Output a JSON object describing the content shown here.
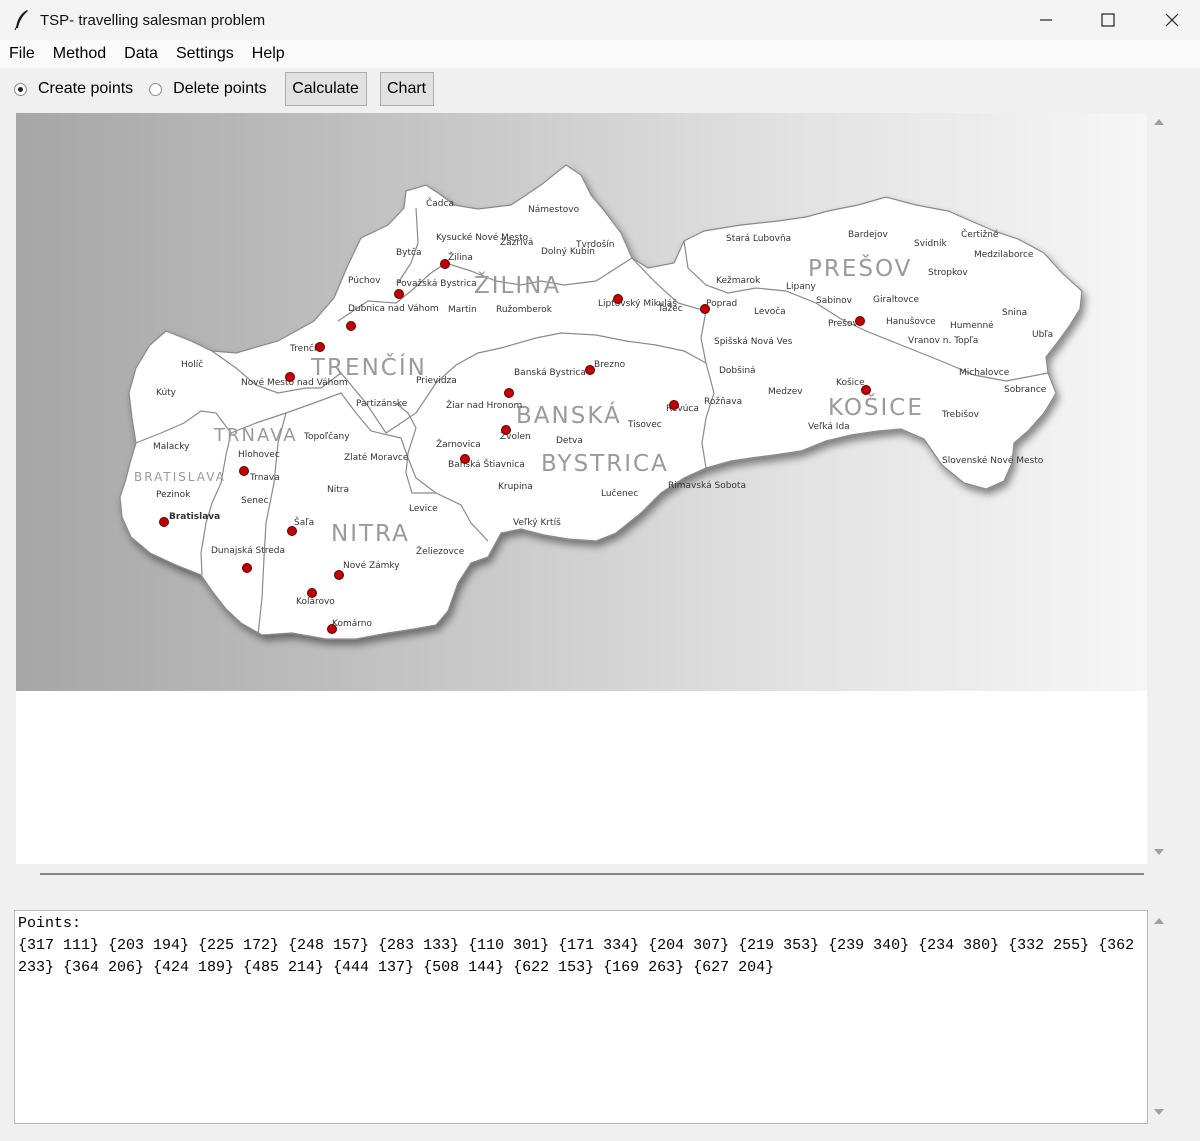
{
  "window": {
    "title": "TSP- travelling salesman problem"
  },
  "menu": [
    "File",
    "Method",
    "Data",
    "Settings",
    "Help"
  ],
  "toolbar": {
    "create_label": "Create points",
    "delete_label": "Delete points",
    "selected_mode": "Create points",
    "calculate_label": "Calculate",
    "chart_label": "Chart"
  },
  "map": {
    "regions": [
      "ŽILINA",
      "TRENČÍN",
      "TRNAVA",
      "BRATISLAVA",
      "NITRA",
      "BANSKÁ",
      "BYSTRICA",
      "PREŠOV",
      "KOŠICE"
    ],
    "towns": [
      "Čadca",
      "Kysucké Nové Mesto",
      "Námestovo",
      "Bytča",
      "Žilina",
      "Zázrivá",
      "Dolný Kubín",
      "Tvrdošín",
      "Púchov",
      "Považská Bystrica",
      "Martin",
      "Ružomberok",
      "Liptovský Mikuláš",
      "Ťažec",
      "Poprad",
      "Dubnica nad Váhom",
      "Trenčín",
      "Holíč",
      "Nové Mesto nad Váhom",
      "Prievidza",
      "Partizánske",
      "Kúty",
      "Malacky",
      "Topoľčany",
      "Hlohovec",
      "Trnava",
      "Pezinok",
      "Bratislava",
      "Senec",
      "Zlaté Moravce",
      "Nitra",
      "Šaľa",
      "Dunajská Streda",
      "Nové Zámky",
      "Komárno",
      "Kolárovo",
      "Levice",
      "Želiezovce",
      "Žiar nad Hronom",
      "Žarnovica",
      "Banská Štiavnica",
      "Zvolen",
      "Banská Bystrica",
      "Brezno",
      "Detva",
      "Tisovec",
      "Krupina",
      "Lučenec",
      "Veľký Krtíš",
      "Rimavská Sobota",
      "Revúca",
      "Rožňava",
      "Stará Ľubovňa",
      "Bardejov",
      "Svidník",
      "Čertižné",
      "Medzilaborce",
      "Stropkov",
      "Kežmarok",
      "Lipany",
      "Sabinov",
      "Giraltovce",
      "Prešov",
      "Hanušovce",
      "Humenné",
      "Snina",
      "Ubľa",
      "Levoča",
      "Spišská Nová Ves",
      "Dobšiná",
      "Medzev",
      "Košice",
      "Vranov n. Topľa",
      "Michalovce",
      "Sobrance",
      "Trebišov",
      "Veľká Ida",
      "Slovenské Nové Mesto"
    ]
  },
  "output": {
    "heading": "Points:",
    "points": "{317 111} {203 194} {225 172} {248 157} {283 133} {110 301} {171 334} {204 307} {219 353} {239 340} {234 380} {332 255} {362 233} {364 206} {424 189} {485 214} {444 137} {508 144} {622 153} {169 263} {627 204}"
  },
  "colors": {
    "marker": "#c00000",
    "map_fill": "#ffffff",
    "border": "#8a8a8a"
  }
}
